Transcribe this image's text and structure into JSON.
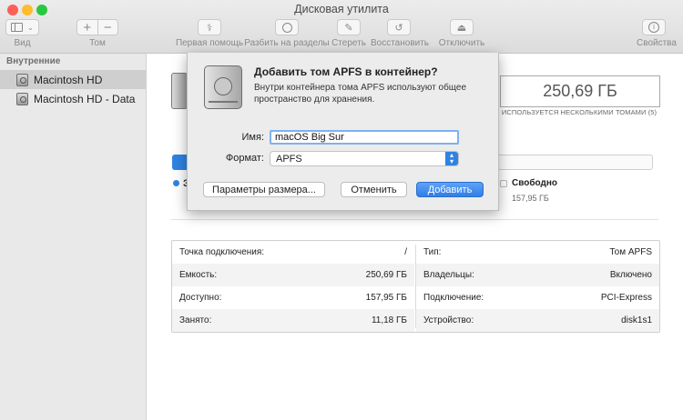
{
  "window": {
    "title": "Дисковая утилита"
  },
  "toolbar": {
    "view_label": "Вид",
    "volume_label": "Том",
    "first_aid_label": "Первая помощь",
    "partition_label": "Разбить на разделы",
    "erase_label": "Стереть",
    "restore_label": "Восстановить",
    "unmount_label": "Отключить",
    "info_label": "Свойства"
  },
  "sidebar": {
    "section": "Внутренние",
    "items": [
      {
        "label": "Macintosh HD",
        "selected": true
      },
      {
        "label": "Macintosh HD - Data",
        "selected": false
      }
    ]
  },
  "main": {
    "capacity": "250,69 ГБ",
    "capacity_caption": "ИСПОЛЬЗУЕТСЯ НЕСКОЛЬКИМИ ТОМАМИ (5)",
    "legend_used_partial": "З",
    "legend_free_label": "Свободно",
    "legend_free_value": "157,95 ГБ",
    "usage_fraction": 0.035,
    "info_left": [
      {
        "key": "Точка подключения:",
        "value": "/"
      },
      {
        "key": "Емкость:",
        "value": "250,69 ГБ"
      },
      {
        "key": "Доступно:",
        "value": "157,95 ГБ"
      },
      {
        "key": "Занято:",
        "value": "11,18 ГБ"
      }
    ],
    "info_right": [
      {
        "key": "Тип:",
        "value": "Том APFS"
      },
      {
        "key": "Владельцы:",
        "value": "Включено"
      },
      {
        "key": "Подключение:",
        "value": "PCI-Express"
      },
      {
        "key": "Устройство:",
        "value": "disk1s1"
      }
    ]
  },
  "dialog": {
    "title": "Добавить том APFS в контейнер?",
    "description": "Внутри контейнера тома APFS используют общее пространство для хранения.",
    "name_label": "Имя:",
    "name_value": "macOS Big Sur",
    "format_label": "Формат:",
    "format_value": "APFS",
    "size_options_button": "Параметры размера...",
    "cancel_button": "Отменить",
    "add_button": "Добавить"
  },
  "colors": {
    "accent": "#2f83e3",
    "close": "#fe5f57",
    "minimize": "#febc2e",
    "zoom": "#28c840"
  }
}
